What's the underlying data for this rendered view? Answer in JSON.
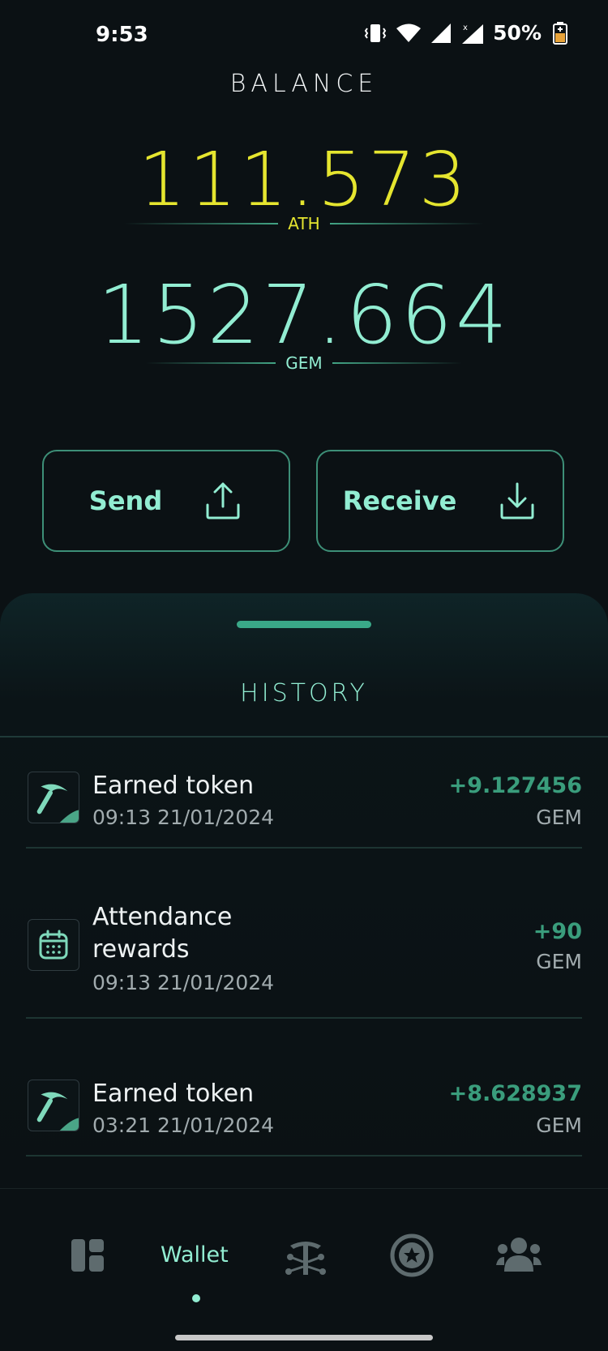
{
  "status": {
    "time": "9:53",
    "battery": "50%"
  },
  "balance": {
    "title": "BALANCE",
    "ath_amount": "111.573",
    "ath_unit": "ATH",
    "gem_amount": "1527.664",
    "gem_unit": "GEM"
  },
  "actions": {
    "send_label": "Send",
    "receive_label": "Receive"
  },
  "history": {
    "title": "HISTORY",
    "items": [
      {
        "title": "Earned token",
        "time": "09:13 21/01/2024",
        "amount": "+9.127456",
        "unit": "GEM",
        "icon": "pickaxe-icon"
      },
      {
        "title": "Attendance rewards",
        "time": "09:13 21/01/2024",
        "amount": "+90",
        "unit": "GEM",
        "icon": "calendar-icon"
      },
      {
        "title": "Earned token",
        "time": "03:21 21/01/2024",
        "amount": "+8.628937",
        "unit": "GEM",
        "icon": "pickaxe-icon"
      }
    ]
  },
  "nav": {
    "active_label": "Wallet",
    "accent": "#92edd2"
  }
}
